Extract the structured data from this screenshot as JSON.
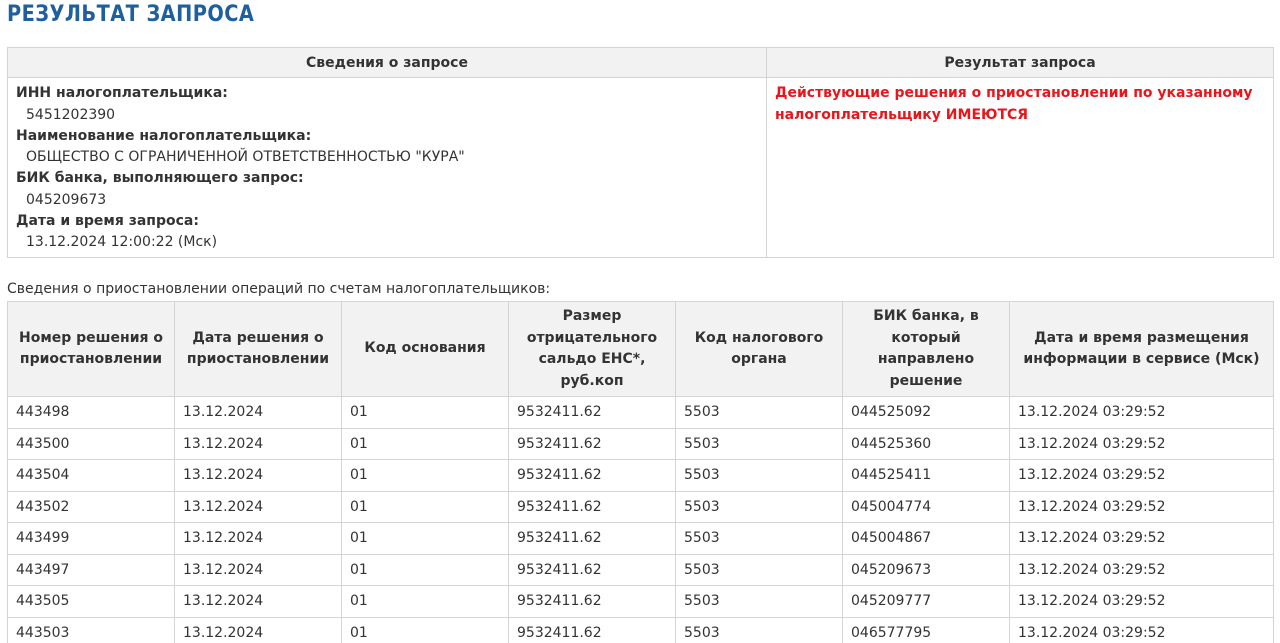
{
  "page": {
    "title": "РЕЗУЛЬТАТ ЗАПРОСА"
  },
  "request_info": {
    "header_left": "Сведения о запросе",
    "header_right": "Результат запроса",
    "inn_label": "ИНН налогоплательщика:",
    "inn_value": "5451202390",
    "name_label": "Наименование налогоплательщика:",
    "name_value": "ОБЩЕСТВО С ОГРАНИЧЕННОЙ ОТВЕТСТВЕННОСТЬЮ \"КУРА\"",
    "bik_label": "БИК банка, выполняющего запрос:",
    "bik_value": "045209673",
    "datetime_label": "Дата и время запроса:",
    "datetime_value": "13.12.2024 12:00:22 (Мск)",
    "result_text": "Действующие решения о приостановлении по указанному налогоплательщику ИМЕЮТСЯ",
    "result_color": "#e8161b"
  },
  "suspensions": {
    "caption": "Сведения о приостановлении операций по счетам налогоплательщиков:",
    "columns": [
      "Номер решения о приостановлении",
      "Дата решения о приостановлении",
      "Код основания",
      "Размер отрицательного сальдо ЕНС*, руб.коп",
      "Код налогового органа",
      "БИК банка, в который направлено решение",
      "Дата и время размещения информации в сервисе (Мск)"
    ],
    "rows": [
      [
        "443498",
        "13.12.2024",
        "01",
        "9532411.62",
        "5503",
        "044525092",
        "13.12.2024 03:29:52"
      ],
      [
        "443500",
        "13.12.2024",
        "01",
        "9532411.62",
        "5503",
        "044525360",
        "13.12.2024 03:29:52"
      ],
      [
        "443504",
        "13.12.2024",
        "01",
        "9532411.62",
        "5503",
        "044525411",
        "13.12.2024 03:29:52"
      ],
      [
        "443502",
        "13.12.2024",
        "01",
        "9532411.62",
        "5503",
        "045004774",
        "13.12.2024 03:29:52"
      ],
      [
        "443499",
        "13.12.2024",
        "01",
        "9532411.62",
        "5503",
        "045004867",
        "13.12.2024 03:29:52"
      ],
      [
        "443497",
        "13.12.2024",
        "01",
        "9532411.62",
        "5503",
        "045209673",
        "13.12.2024 03:29:52"
      ],
      [
        "443505",
        "13.12.2024",
        "01",
        "9532411.62",
        "5503",
        "045209777",
        "13.12.2024 03:29:52"
      ],
      [
        "443503",
        "13.12.2024",
        "01",
        "9532411.62",
        "5503",
        "046577795",
        "13.12.2024 03:29:52"
      ]
    ]
  },
  "colors": {
    "title": "#1f5f9e",
    "header_bg": "#f2f2f2",
    "border": "#d4d4d4",
    "text": "#333333"
  }
}
